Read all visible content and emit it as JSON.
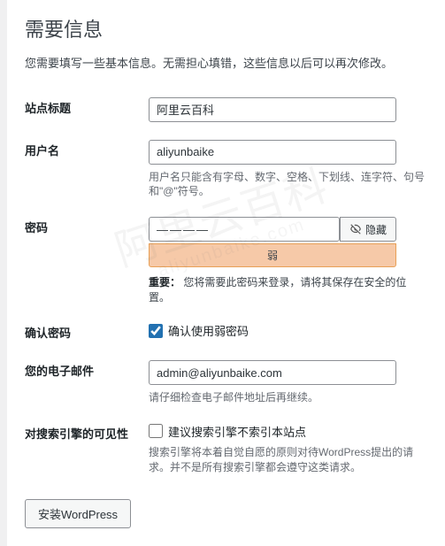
{
  "heading": "需要信息",
  "intro": "您需要填写一些基本信息。无需担心填错，这些信息以后可以再次修改。",
  "fields": {
    "site_title": {
      "label": "站点标题",
      "value": "阿里云百科"
    },
    "username": {
      "label": "用户名",
      "value": "aliyunbaike",
      "hint": "用户名只能含有字母、数字、空格、下划线、连字符、句号和\"@\"符号。"
    },
    "password": {
      "label": "密码",
      "masked": "————",
      "hide_button": "隐藏",
      "strength": "弱",
      "important_label": "重要：",
      "important_text": "您将需要此密码来登录，请将其保存在安全的位置。"
    },
    "confirm_pw": {
      "label": "确认密码",
      "checkbox_label": "确认使用弱密码",
      "checked": true
    },
    "email": {
      "label": "您的电子邮件",
      "value": "admin@aliyunbaike.com",
      "hint": "请仔细检查电子邮件地址后再继续。"
    },
    "visibility": {
      "label": "对搜索引擎的可见性",
      "checkbox_label": "建议搜索引擎不索引本站点",
      "hint": "搜索引擎将本着自觉自愿的原则对待WordPress提出的请求。并不是所有搜索引擎都会遵守这类请求。"
    }
  },
  "submit": "安装WordPress",
  "watermark": {
    "main": "阿里云百科",
    "sub": "aliyunbaike.com"
  }
}
